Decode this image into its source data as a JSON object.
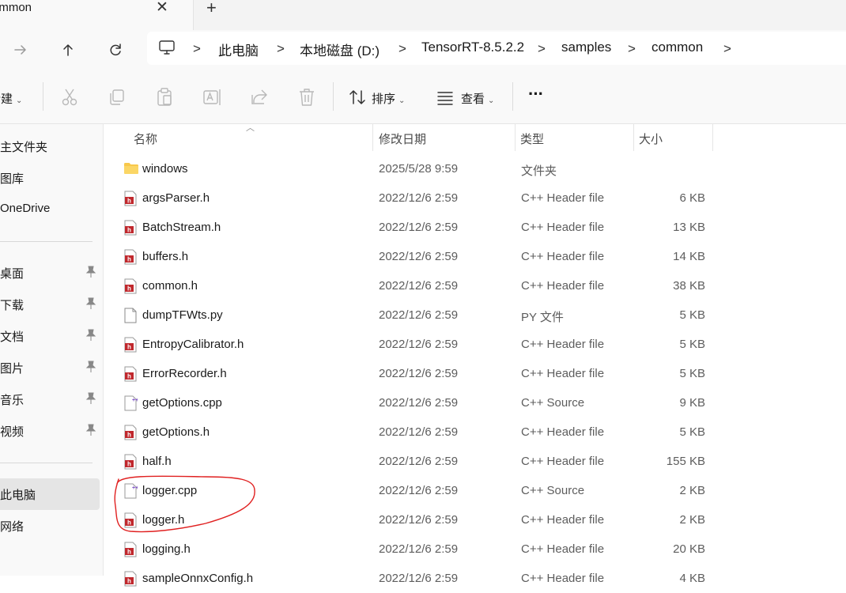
{
  "tab": {
    "title": "ommon",
    "close_glyph": "✕",
    "new_tab_glyph": "+"
  },
  "nav": {
    "forward_icon": "arrow-right-icon",
    "up_icon": "arrow-up-icon",
    "refresh_icon": "refresh-icon",
    "breadcrumbs": [
      "此电脑",
      "本地磁盘 (D:)",
      "TensorRT-8.5.2.2",
      "samples",
      "common"
    ],
    "separator": ">"
  },
  "toolbar": {
    "new_label": "新建",
    "sort_label": "排序",
    "view_label": "查看",
    "more_label": "···",
    "caret": "⌄",
    "icons": [
      "cut-icon",
      "copy-icon",
      "paste-icon",
      "rename-icon",
      "share-icon",
      "delete-icon"
    ]
  },
  "sidebar": {
    "top_items": [
      "主文件夹",
      "图库",
      "OneDrive"
    ],
    "quick_access": [
      "桌面",
      "下载",
      "文档",
      "图片",
      "音乐",
      "视频"
    ],
    "bottom_items": [
      "此电脑",
      "网络"
    ],
    "selected": "此电脑"
  },
  "columns": {
    "name": "名称",
    "date": "修改日期",
    "type": "类型",
    "size": "大小"
  },
  "files": [
    {
      "name": "windows",
      "date": "2025/5/28 9:59",
      "type": "文件夹",
      "size": "",
      "icon": "folder-icon"
    },
    {
      "name": "argsParser.h",
      "date": "2022/12/6 2:59",
      "type": "C++ Header file",
      "size": "6 KB",
      "icon": "header-file-icon"
    },
    {
      "name": "BatchStream.h",
      "date": "2022/12/6 2:59",
      "type": "C++ Header file",
      "size": "13 KB",
      "icon": "header-file-icon"
    },
    {
      "name": "buffers.h",
      "date": "2022/12/6 2:59",
      "type": "C++ Header file",
      "size": "14 KB",
      "icon": "header-file-icon"
    },
    {
      "name": "common.h",
      "date": "2022/12/6 2:59",
      "type": "C++ Header file",
      "size": "38 KB",
      "icon": "header-file-icon"
    },
    {
      "name": "dumpTFWts.py",
      "date": "2022/12/6 2:59",
      "type": "PY 文件",
      "size": "5 KB",
      "icon": "generic-file-icon"
    },
    {
      "name": "EntropyCalibrator.h",
      "date": "2022/12/6 2:59",
      "type": "C++ Header file",
      "size": "5 KB",
      "icon": "header-file-icon"
    },
    {
      "name": "ErrorRecorder.h",
      "date": "2022/12/6 2:59",
      "type": "C++ Header file",
      "size": "5 KB",
      "icon": "header-file-icon"
    },
    {
      "name": "getOptions.cpp",
      "date": "2022/12/6 2:59",
      "type": "C++ Source",
      "size": "9 KB",
      "icon": "cpp-source-icon"
    },
    {
      "name": "getOptions.h",
      "date": "2022/12/6 2:59",
      "type": "C++ Header file",
      "size": "5 KB",
      "icon": "header-file-icon"
    },
    {
      "name": "half.h",
      "date": "2022/12/6 2:59",
      "type": "C++ Header file",
      "size": "155 KB",
      "icon": "header-file-icon"
    },
    {
      "name": "logger.cpp",
      "date": "2022/12/6 2:59",
      "type": "C++ Source",
      "size": "2 KB",
      "icon": "cpp-source-icon"
    },
    {
      "name": "logger.h",
      "date": "2022/12/6 2:59",
      "type": "C++ Header file",
      "size": "2 KB",
      "icon": "header-file-icon"
    },
    {
      "name": "logging.h",
      "date": "2022/12/6 2:59",
      "type": "C++ Header file",
      "size": "20 KB",
      "icon": "header-file-icon"
    },
    {
      "name": "sampleOnnxConfig.h",
      "date": "2022/12/6 2:59",
      "type": "C++ Header file",
      "size": "4 KB",
      "icon": "header-file-icon"
    }
  ],
  "colors": {
    "annotation": "#e02020",
    "header_icon_red": "#c0282d",
    "folder": "#f8c84b",
    "cpp_accent": "#7a4dc4"
  }
}
